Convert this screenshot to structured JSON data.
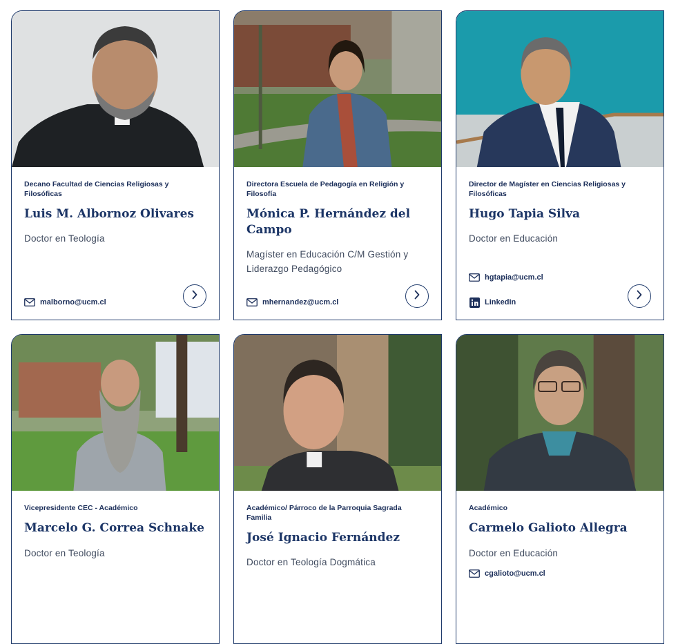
{
  "cards": [
    {
      "role": "Decano Facultad de Ciencias Religiosas y Filosóficas",
      "name": "Luis M. Albornoz Olivares",
      "degree": "Doctor en Teología",
      "contacts": [
        {
          "icon": "mail-icon",
          "text": "malborno@ucm.cl"
        }
      ],
      "photo_bg": "#dcdedf",
      "icons": {
        "arrow": "chevron-right-icon"
      }
    },
    {
      "role": "Directora Escuela de Pedagogía en Religión y Filosofía",
      "name": "Mónica P. Hernández del Campo",
      "degree": "Magíster en Educación C/M Gestión y Liderazgo Pedagógico",
      "contacts": [
        {
          "icon": "mail-icon",
          "text": "mhernandez@ucm.cl"
        }
      ],
      "photo_bg": "#5f7a4a"
    },
    {
      "role": "Director de Magíster en Ciencias Religiosas y Filosóficas",
      "name": "Hugo Tapia Silva",
      "degree": "Doctor en Educación",
      "contacts": [
        {
          "icon": "mail-icon",
          "text": "hgtapia@ucm.cl"
        },
        {
          "icon": "linkedin-icon",
          "text": "LinkedIn"
        }
      ],
      "photo_bg": "#1d9aa8"
    },
    {
      "role": "Vicepresidente CEC - Académico",
      "name": "Marcelo G. Correa Schnake",
      "degree": "Doctor en Teología",
      "contacts": [],
      "photo_bg": "#6d8f5a"
    },
    {
      "role": "Académico/ Párroco de la Parroquia Sagrada Familia",
      "name": "José Ignacio Fernández",
      "degree": "Doctor en Teología Dogmática",
      "contacts": [],
      "photo_bg": "#8a7a66"
    },
    {
      "role": "Académico",
      "name": "Carmelo Galioto Allegra",
      "degree": "Doctor en Educación",
      "contacts": [
        {
          "icon": "mail-icon",
          "text": "cgalioto@ucm.cl"
        }
      ],
      "photo_bg": "#546b46"
    }
  ],
  "colors": {
    "accent": "#1f3a6b",
    "text_dark": "#1c2f5a",
    "text_body": "#3f4a5e"
  }
}
